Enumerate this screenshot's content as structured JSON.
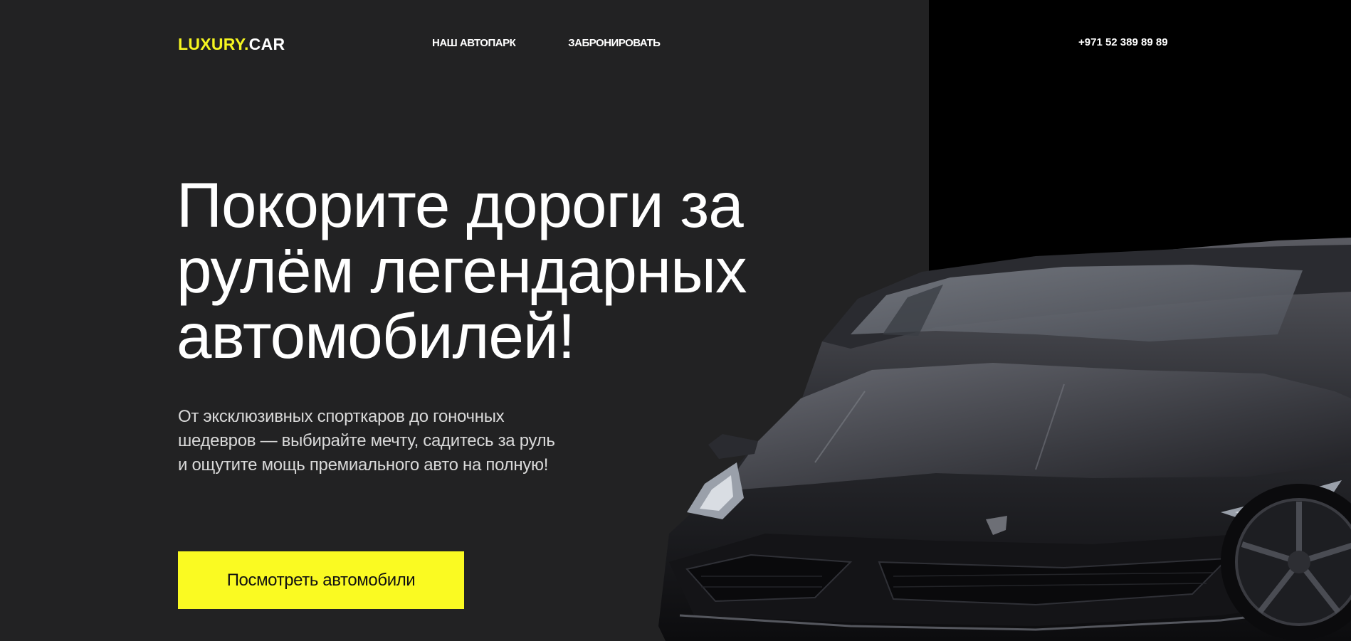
{
  "header": {
    "logo": {
      "accent": "LUXURY.",
      "rest": "CAR"
    },
    "nav": [
      {
        "label": "НАШ АВТОПАРК"
      },
      {
        "label": "ЗАБРОНИРОВАТЬ"
      }
    ],
    "phone": "+971 52 389 89 89"
  },
  "hero": {
    "title_lines": [
      "Покорите дороги за",
      "рулём легендарных",
      "автомобилей!"
    ],
    "text": "От эксклюзивных спорткаров до гоночных шедевров — выбирайте мечту, садитесь за руль и ощутите мощь премиального авто на полную!",
    "cta_label": "Посмотреть автомобили"
  },
  "colors": {
    "background": "#222223",
    "panel": "#000000",
    "accent": "#f5f520",
    "button": "#fafa22"
  },
  "icons": [
    "car-image"
  ]
}
